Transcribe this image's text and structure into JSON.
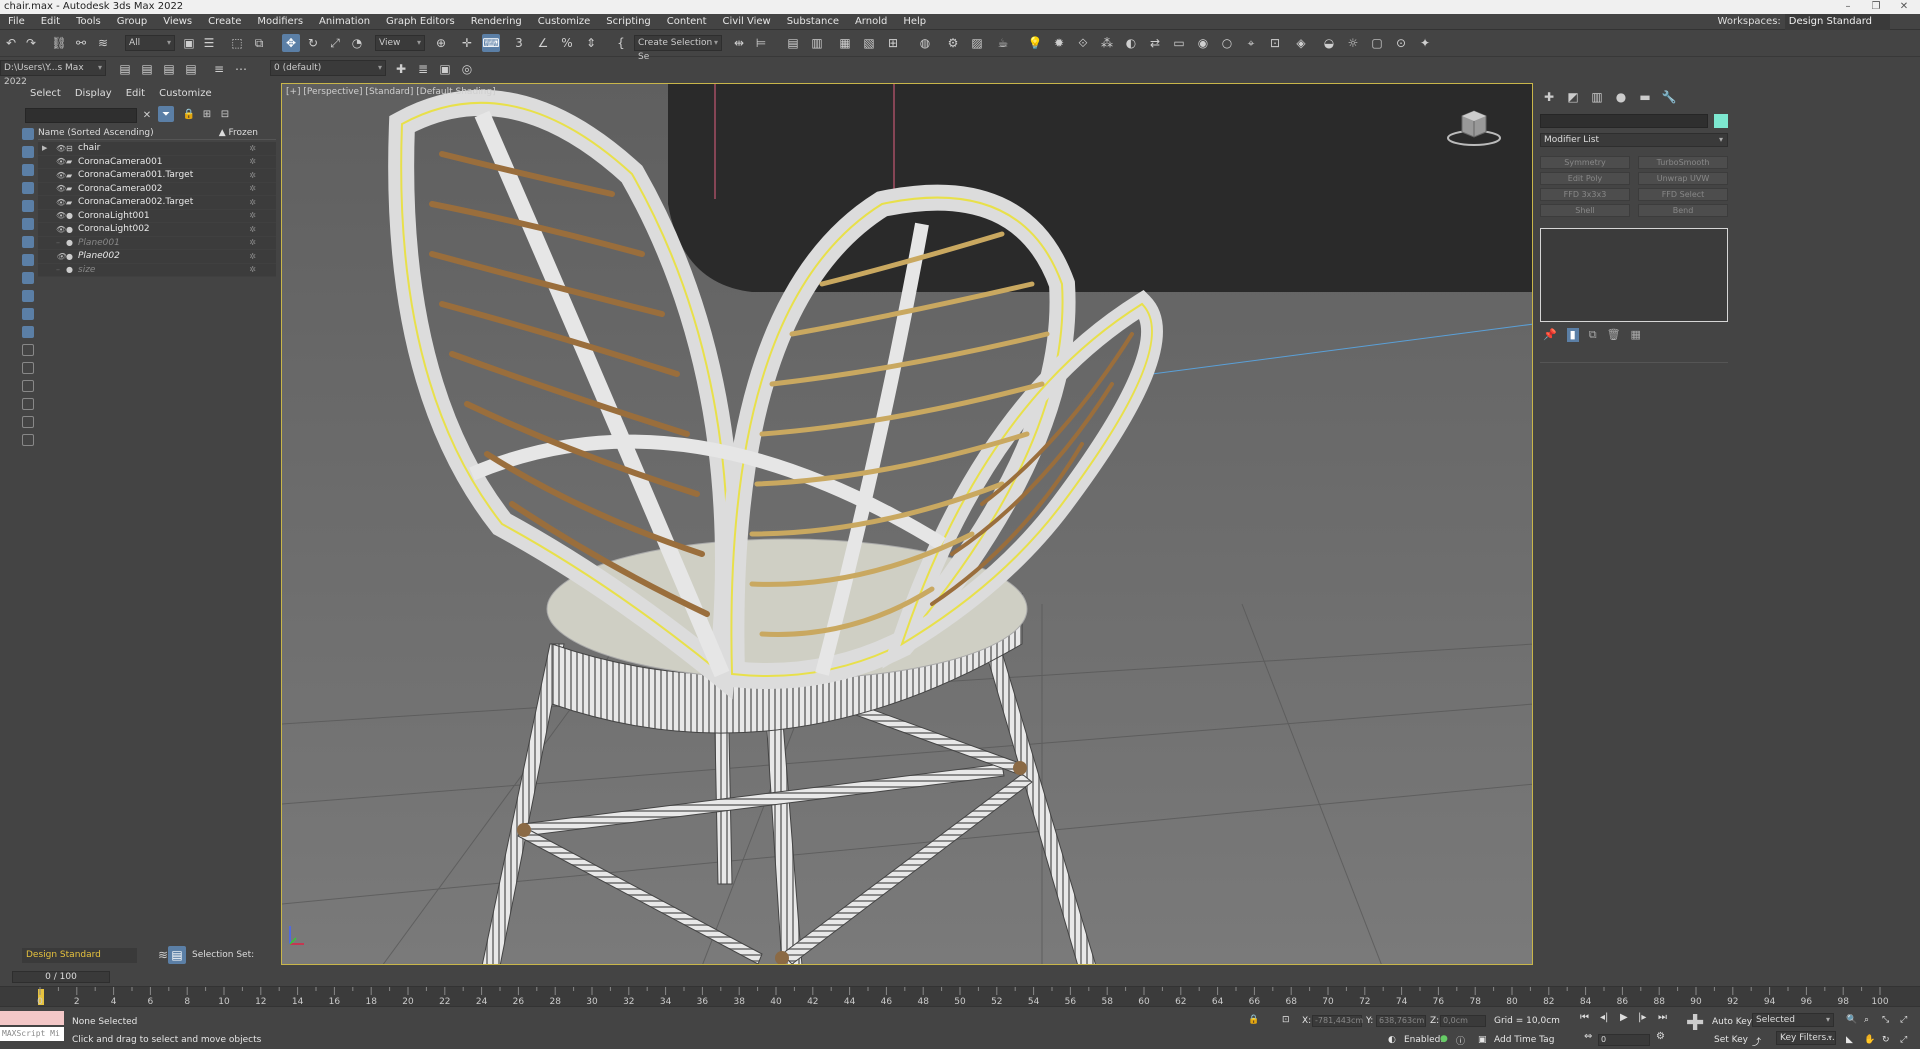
{
  "window": {
    "title": "chair.max - Autodesk 3ds Max 2022"
  },
  "menu": [
    "File",
    "Edit",
    "Tools",
    "Group",
    "Views",
    "Create",
    "Modifiers",
    "Animation",
    "Graph Editors",
    "Rendering",
    "Customize",
    "Scripting",
    "Content",
    "Civil View",
    "Substance",
    "Arnold",
    "Help"
  ],
  "workspace": {
    "label": "Workspaces:",
    "value": "Design Standard"
  },
  "toolbar": {
    "filter_value": "All",
    "refcoord_value": "View",
    "selection_set_value": "Create Selection Se",
    "path_value": "D:\\Users\\Y...s Max 2022",
    "layer_value": "0 (default)"
  },
  "explorer": {
    "tabs": [
      "Select",
      "Display",
      "Edit",
      "Customize"
    ],
    "col_name": "Name (Sorted Ascending)",
    "col_frozen": "▲ Frozen",
    "rows": [
      {
        "name": "chair",
        "type": "group",
        "hidden": false
      },
      {
        "name": "CoronaCamera001",
        "type": "camera",
        "hidden": false
      },
      {
        "name": "CoronaCamera001.Target",
        "type": "camera",
        "hidden": false
      },
      {
        "name": "CoronaCamera002",
        "type": "camera",
        "hidden": false
      },
      {
        "name": "CoronaCamera002.Target",
        "type": "camera",
        "hidden": false
      },
      {
        "name": "CoronaLight001",
        "type": "light",
        "hidden": false
      },
      {
        "name": "CoronaLight002",
        "type": "light",
        "hidden": false
      },
      {
        "name": "Plane001",
        "type": "geo",
        "hidden": true
      },
      {
        "name": "Plane002",
        "type": "geo",
        "hidden": false
      },
      {
        "name": "size",
        "type": "geo",
        "hidden": true
      }
    ],
    "workspace_bottom": "Design Standard",
    "selection_set_label": "Selection Set:"
  },
  "viewport": {
    "label": "[+] [Perspective] [Standard] [Default Shading]"
  },
  "command_panel": {
    "modifier_list": "Modifier List",
    "modifier_buttons": [
      "Symmetry",
      "TurboSmooth",
      "Edit Poly",
      "Unwrap UVW",
      "FFD 3x3x3",
      "FFD Select",
      "Shell",
      "Bend"
    ],
    "object_color": "#7de8d0"
  },
  "timeline": {
    "frame_display": "0 / 100",
    "ticks": [
      0,
      2,
      4,
      6,
      8,
      10,
      12,
      14,
      16,
      18,
      20,
      22,
      24,
      26,
      28,
      30,
      32,
      34,
      36,
      38,
      40,
      42,
      44,
      46,
      48,
      50,
      52,
      54,
      56,
      58,
      60,
      62,
      64,
      66,
      68,
      70,
      72,
      74,
      76,
      78,
      80,
      82,
      84,
      86,
      88,
      90,
      92,
      94,
      96,
      98,
      100
    ]
  },
  "status": {
    "maxscript_placeholder": "MAXScript Mi",
    "selection": "None Selected",
    "prompt": "Click and drag to select and move objects",
    "x_label": "X:",
    "x_value": "-781,443cm",
    "y_label": "Y:",
    "y_value": "638,763cm",
    "z_label": "Z:",
    "z_value": "0,0cm",
    "grid": "Grid = 10,0cm",
    "enabled_label": "Enabled:",
    "add_time_tag": "Add Time Tag",
    "auto_key": "Auto Key",
    "set_key": "Set Key",
    "key_mode": "Selected",
    "key_filters": "Key Filters...",
    "current_frame": "0"
  },
  "colors": {
    "accent": "#5b7fa6",
    "selection_outline": "#e8e04a",
    "viewport_border": "#c9b64a"
  }
}
